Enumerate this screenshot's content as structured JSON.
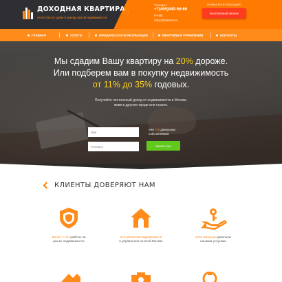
{
  "header": {
    "logo_title": "ДОХОДНАЯ КВАРТИРА",
    "logo_subtitle": "Агентство по сдаче в аренду жилой недвижимости",
    "phone_label": "Телефон:",
    "phone": "+7(495)940-56-66",
    "email_label": "E-mail:",
    "email": "zakaz@dohnos.ru",
    "callback_label": "НУЖНА КОНСУЛЬТАЦИЯ?",
    "callback_button": "Бесплатный звонок"
  },
  "nav": {
    "items": [
      {
        "label": "ГЛАВНАЯ"
      },
      {
        "label": "УСЛУГИ"
      },
      {
        "label": "ЮРИДИЧЕСКАЯ КОНСУЛЬТАЦИЯ"
      },
      {
        "label": "КВАРТИРЫ В УПРАВЛЕНИИ"
      },
      {
        "label": "КОНТАКТЫ"
      }
    ]
  },
  "hero": {
    "line1_pre": "Мы сдадим Вашу квартиру на ",
    "line1_accent": "20%",
    "line1_post": " дороже.",
    "line2": "Или подберем вам в покупку недвижимость",
    "line3_accent": "от 11% до 35%",
    "line3_post": " годовых.",
    "subtitle1": "Получайте постоянный доход от недвижимости в Москве,",
    "subtitle2": "живя в другом городе или стране."
  },
  "form": {
    "name_placeholder": "Имя",
    "phone_placeholder": "Телефон",
    "note_pre": "Уже ",
    "note_number": "278",
    "note_post": " довольных",
    "note_line2": "собственников",
    "submit_label": "Узнать как"
  },
  "clients": {
    "title": "КЛИЕНТЫ ДОВЕРЯЮТ НАМ",
    "features": [
      {
        "icon": "shield-icon",
        "hl": "Более 7 лет",
        "text": " работы на",
        "line2": "рынке недвижимости"
      },
      {
        "icon": "house-icon",
        "hl": "275 объектов недвижимости",
        "text": "",
        "line2": "в управлении по всей Москве"
      },
      {
        "icon": "hand-key-icon",
        "hl": "1755 жильцов",
        "text": " довольны",
        "line2": "нашими услугами"
      }
    ]
  },
  "colors": {
    "accent": "#ff8c1a",
    "dark": "#2f2f33",
    "highlight": "#ffd21f",
    "button_green": "#61c81e",
    "button_red": "#ff3b1f"
  }
}
